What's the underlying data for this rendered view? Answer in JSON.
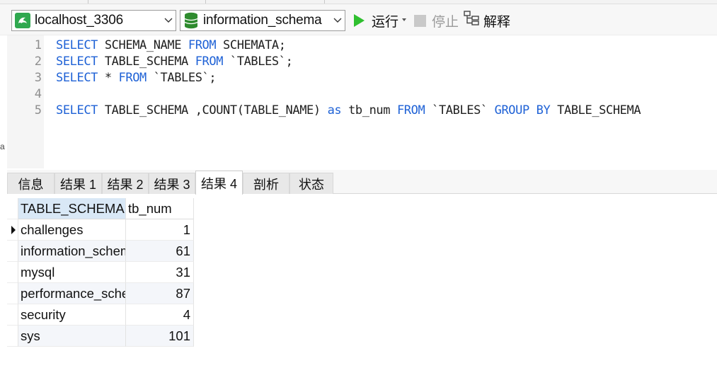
{
  "toolbar": {
    "connection": "localhost_3306",
    "database": "information_schema",
    "run_label": "运行",
    "stop_label": "停止",
    "explain_label": "解释"
  },
  "editor": {
    "line_numbers": [
      "1",
      "2",
      "3",
      "4",
      "5"
    ],
    "lines": [
      [
        {
          "t": "SELECT",
          "k": true
        },
        {
          "t": " SCHEMA_NAME ",
          "k": false
        },
        {
          "t": "FROM",
          "k": true
        },
        {
          "t": " SCHEMATA;",
          "k": false
        }
      ],
      [
        {
          "t": "SELECT",
          "k": true
        },
        {
          "t": " TABLE_SCHEMA ",
          "k": false
        },
        {
          "t": "FROM",
          "k": true
        },
        {
          "t": " `TABLES`;",
          "k": false
        }
      ],
      [
        {
          "t": "SELECT",
          "k": true
        },
        {
          "t": " * ",
          "k": false
        },
        {
          "t": "FROM",
          "k": true
        },
        {
          "t": " `TABLES`;",
          "k": false
        }
      ],
      [],
      [
        {
          "t": "SELECT",
          "k": true
        },
        {
          "t": " TABLE_SCHEMA ,COUNT(TABLE_NAME) ",
          "k": false
        },
        {
          "t": "as",
          "k": true
        },
        {
          "t": " tb_num ",
          "k": false
        },
        {
          "t": "FROM",
          "k": true
        },
        {
          "t": " `TABLES` ",
          "k": false
        },
        {
          "t": "GROUP BY",
          "k": true
        },
        {
          "t": " TABLE_SCHEMA",
          "k": false
        }
      ]
    ],
    "side_marker": "a"
  },
  "tabs": [
    {
      "label": "信息",
      "active": false
    },
    {
      "label": "结果 1",
      "active": false
    },
    {
      "label": "结果 2",
      "active": false
    },
    {
      "label": "结果 3",
      "active": false
    },
    {
      "label": "结果 4",
      "active": true
    },
    {
      "label": "剖析",
      "active": false
    },
    {
      "label": "状态",
      "active": false
    }
  ],
  "result": {
    "columns": [
      "TABLE_SCHEMA",
      "tb_num"
    ],
    "rows": [
      {
        "schema": "challenges",
        "num": "1"
      },
      {
        "schema": "information_schema",
        "num": "61"
      },
      {
        "schema": "mysql",
        "num": "31"
      },
      {
        "schema": "performance_schema",
        "num": "87"
      },
      {
        "schema": "security",
        "num": "4"
      },
      {
        "schema": "sys",
        "num": "101"
      }
    ],
    "current_row": 0
  },
  "colors": {
    "keyword": "#1f62d6",
    "run_green": "#2fbf2f",
    "db_green": "#2e8b2e",
    "header_selected": "#d9e8f6"
  },
  "icons": {
    "connection": "mysql-dolphin-icon",
    "database": "database-cylinder-icon",
    "run": "play-icon",
    "stop": "stop-square-icon",
    "explain": "explain-tree-icon"
  }
}
